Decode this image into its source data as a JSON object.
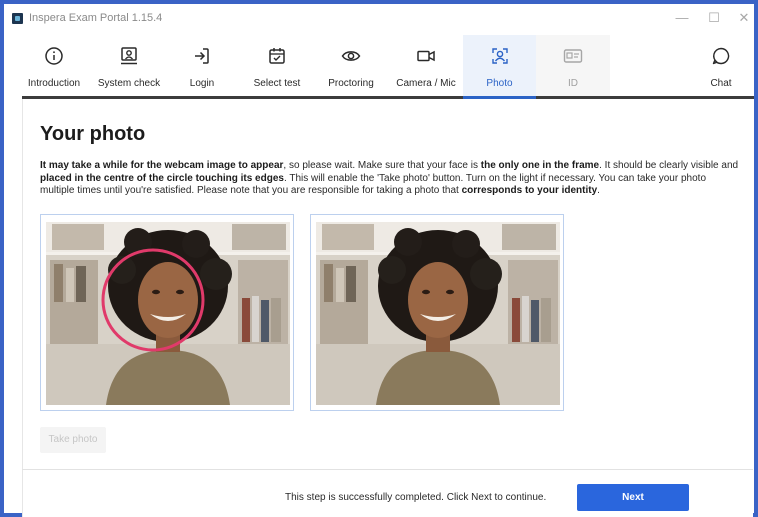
{
  "window": {
    "title": "Inspera Exam Portal 1.15.4",
    "controls": {
      "minimize": "—",
      "maximize": "☐",
      "close": "✕"
    }
  },
  "steps": [
    {
      "label": "Introduction",
      "icon": "info-icon",
      "state": "normal"
    },
    {
      "label": "System check",
      "icon": "system-check-icon",
      "state": "normal"
    },
    {
      "label": "Login",
      "icon": "login-icon",
      "state": "normal"
    },
    {
      "label": "Select test",
      "icon": "calendar-check-icon",
      "state": "normal"
    },
    {
      "label": "Proctoring",
      "icon": "eye-icon",
      "state": "normal"
    },
    {
      "label": "Camera / Mic",
      "icon": "video-camera-icon",
      "state": "normal"
    },
    {
      "label": "Photo",
      "icon": "face-scan-icon",
      "state": "active"
    },
    {
      "label": "ID",
      "icon": "id-card-icon",
      "state": "disabled"
    }
  ],
  "chat": {
    "label": "Chat",
    "icon": "chat-bubble-icon"
  },
  "page": {
    "title": "Your photo",
    "intro": {
      "b1": "It may take a while for the webcam image to appear",
      "t1": ", so please wait. Make sure that your face is ",
      "b2": "the only one in the frame",
      "t2": ". It should be clearly visible and ",
      "b3": "placed in the centre of the circle touching its edges",
      "t3": ". This will enable the 'Take photo' button. Turn on the light if necessary. You can take your photo multiple times until you're satisfied. Please note that you are responsible for taking a photo that ",
      "b4": "corresponds to your identity",
      "t4": "."
    },
    "take_photo_label": "Take photo"
  },
  "footer": {
    "status_text": "This step is successfully completed. Click Next to continue.",
    "next_label": "Next"
  },
  "colors": {
    "accent": "#2a66dd",
    "active_step_bg": "#ecf2fb",
    "frame_circle": "#e03a6a",
    "window_border": "#3a63c6"
  }
}
